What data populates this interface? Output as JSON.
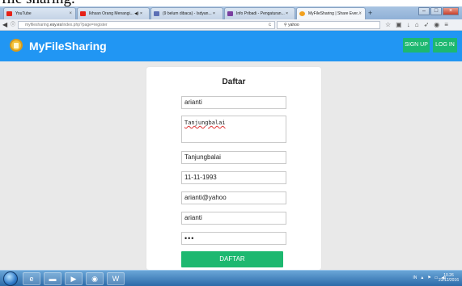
{
  "caption": "file sharing.",
  "browser": {
    "tabs": [
      {
        "label": "YouTube",
        "icon_color": "#e62117"
      },
      {
        "label": "Ikhsan Orang Menangi... ◀) ×",
        "icon_color": "#e62117"
      },
      {
        "label": "(9 belum dibaca) - Isdyan... ×",
        "icon_color": "#5b6fb5"
      },
      {
        "label": "Info Pribadi - Pengaturan... ×",
        "icon_color": "#7a3fa0"
      },
      {
        "label": "MyFileSharing | Share Ever...",
        "icon_color": "#f2a11e"
      }
    ],
    "new_tab": "+",
    "url_prefix": "myfilesharing.",
    "url_domain": "esy.es",
    "url_path": "/index.php?page=register",
    "search_value": "yahoo",
    "window_controls": [
      "–",
      "□",
      "×"
    ]
  },
  "app": {
    "brand": "MyFileSharing",
    "signup_label": "SIGN UP",
    "login_label": "LOG IN"
  },
  "form": {
    "title": "Daftar",
    "name_value": "arianti",
    "address_value": "Tanjungbalai",
    "city_value": "Tanjungbalai",
    "dob_value": "11-11-1993",
    "email_value": "arianti@yahoo",
    "username_value": "arianti",
    "password_masked": "•••",
    "submit_label": "DAFTAR"
  },
  "taskbar": {
    "clock_time": "10.26",
    "clock_date": "23/12/2016",
    "tray_lang": "IN"
  }
}
